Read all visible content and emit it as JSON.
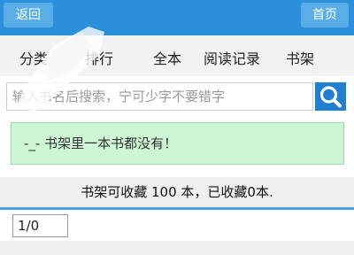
{
  "header": {
    "back_label": "返回",
    "home_label": "首页"
  },
  "nav": {
    "items": [
      {
        "label": "分类"
      },
      {
        "label": "排行"
      },
      {
        "label": "全本"
      },
      {
        "label": "阅读记录"
      },
      {
        "label": "书架"
      }
    ]
  },
  "search": {
    "placeholder": "输入书名后搜索，宁可少字不要错字",
    "button_icon": "search-icon"
  },
  "notice": {
    "text": "-_- 书架里一本书都没有！"
  },
  "bookshelf": {
    "capacity_text": "书架可收藏 100 本，已收藏0本."
  },
  "pagination": {
    "value": "1/0"
  },
  "colors": {
    "header": "#2b8fd9",
    "header_button": "#5aaee8",
    "search_button": "#1f7fd0",
    "notice_bg": "#cdf7d4",
    "accent_line": "#4aa3e3"
  }
}
